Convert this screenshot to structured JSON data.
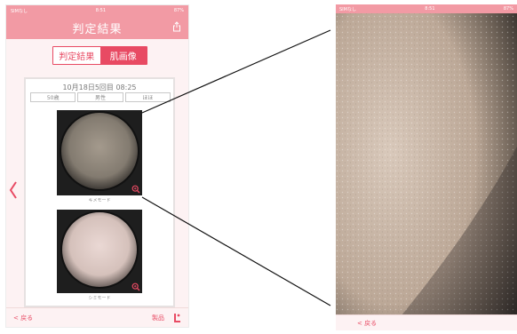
{
  "left_phone": {
    "status": {
      "carrier": "SIMなし",
      "time": "8:51",
      "battery": "87%"
    },
    "nav": {
      "title": "判定結果"
    },
    "segment": {
      "result_label": "判定結果",
      "skin_image_label": "肌画像"
    },
    "card": {
      "datetime": "10月18日5回目 08:25",
      "age": "50歳",
      "gender": "男性",
      "third": "ほほ"
    },
    "images": [
      {
        "caption": "キメモード"
      },
      {
        "caption": "シミモード"
      }
    ],
    "bottom": {
      "back_label": "< 戻る",
      "product_label": "製品"
    }
  },
  "right_phone": {
    "status": {
      "carrier": "SIMなし",
      "time": "8:51",
      "battery": "87%"
    },
    "bottom": {
      "back_label": "< 戻る"
    }
  },
  "colors": {
    "accent": "#e84a63",
    "header": "#f29aa4",
    "background": "#fdf2f3"
  },
  "icons": [
    "share-icon",
    "chevron-left-icon",
    "zoom-icon",
    "person-icon"
  ]
}
